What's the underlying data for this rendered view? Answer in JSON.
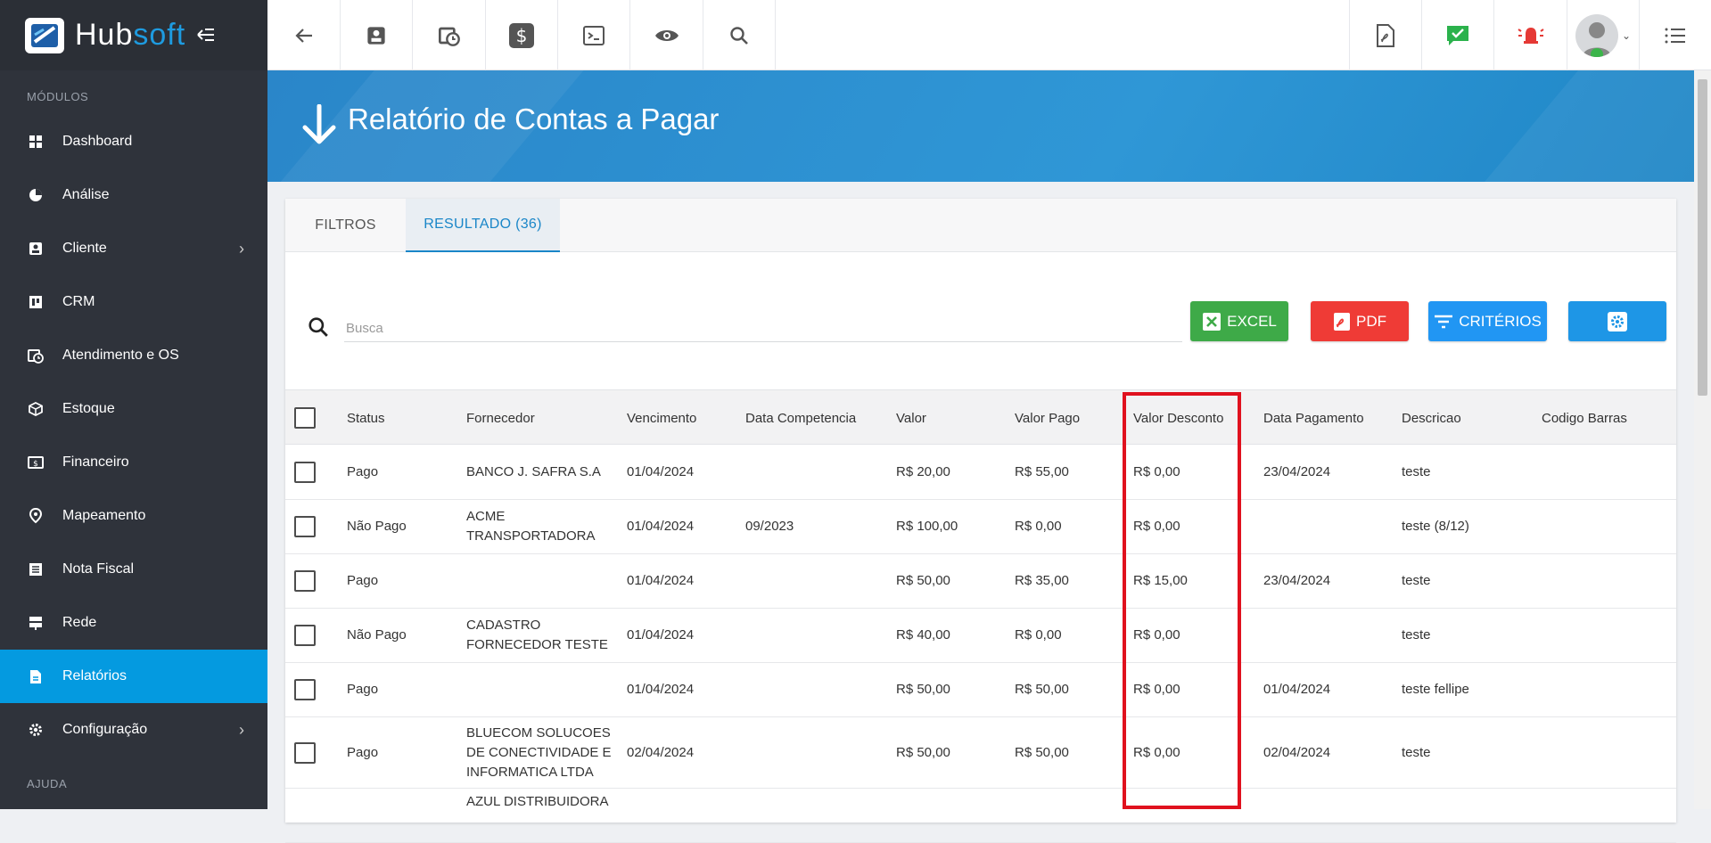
{
  "brand": {
    "name_part1": "Hub",
    "name_part2": "soft"
  },
  "sidebar": {
    "modules_label": "MÓDULOS",
    "help_label": "AJUDA",
    "items": [
      {
        "label": "Dashboard",
        "icon": "dashboard-icon"
      },
      {
        "label": "Análise",
        "icon": "pie-chart-icon"
      },
      {
        "label": "Cliente",
        "icon": "contact-card-icon",
        "has_submenu": true
      },
      {
        "label": "CRM",
        "icon": "kanban-icon"
      },
      {
        "label": "Atendimento e OS",
        "icon": "calendar-clock-icon"
      },
      {
        "label": "Estoque",
        "icon": "box-icon"
      },
      {
        "label": "Financeiro",
        "icon": "money-icon"
      },
      {
        "label": "Mapeamento",
        "icon": "map-pin-icon"
      },
      {
        "label": "Nota Fiscal",
        "icon": "invoice-icon"
      },
      {
        "label": "Rede",
        "icon": "server-icon"
      },
      {
        "label": "Relatórios",
        "icon": "report-icon",
        "active": true
      },
      {
        "label": "Configuração",
        "icon": "gear-icon",
        "has_submenu": true
      }
    ]
  },
  "topbar": {
    "icons": [
      "back-arrow-icon",
      "contact-card-icon",
      "calendar-clock-icon",
      "dollar-icon",
      "terminal-icon",
      "eye-icon",
      "search-icon",
      "pdf-icon",
      "chat-check-icon",
      "alarm-icon",
      "avatar",
      "list-menu-icon"
    ]
  },
  "page": {
    "title": "Relatório de Contas a Pagar"
  },
  "tabs": {
    "filters": "FILTROS",
    "result": "RESULTADO (36)"
  },
  "search": {
    "placeholder": "Busca",
    "value": ""
  },
  "actions": {
    "excel": "EXCEL",
    "pdf": "PDF",
    "criteria": "CRITÉRIOS"
  },
  "colors": {
    "sidebar_bg": "#2f333b",
    "accent": "#049ae0",
    "excel": "#3eaa48",
    "pdf": "#ef3b36",
    "criteria": "#2196f3",
    "settings": "#1e96e6",
    "highlight": "#e0111e"
  },
  "table": {
    "headers": {
      "status": "Status",
      "supplier": "Fornecedor",
      "due": "Vencimento",
      "competence": "Data Competencia",
      "value": "Valor",
      "paid": "Valor Pago",
      "discount": "Valor Desconto",
      "payment_date": "Data Pagamento",
      "description": "Descricao",
      "barcode": "Codigo Barras"
    },
    "rows": [
      {
        "status": "Pago",
        "supplier": "BANCO J. SAFRA S.A",
        "due": "01/04/2024",
        "competence": "",
        "value": "R$ 20,00",
        "paid": "R$ 55,00",
        "discount": "R$ 0,00",
        "payment_date": "23/04/2024",
        "description": "teste",
        "barcode": ""
      },
      {
        "status": "Não Pago",
        "supplier": "ACME\nTRANSPORTADORA",
        "due": "01/04/2024",
        "competence": "09/2023",
        "value": "R$ 100,00",
        "paid": "R$ 0,00",
        "discount": "R$ 0,00",
        "payment_date": "",
        "description": "teste (8/12)",
        "barcode": ""
      },
      {
        "status": "Pago",
        "supplier": "",
        "due": "01/04/2024",
        "competence": "",
        "value": "R$ 50,00",
        "paid": "R$ 35,00",
        "discount": "R$ 15,00",
        "payment_date": "23/04/2024",
        "description": "teste",
        "barcode": ""
      },
      {
        "status": "Não Pago",
        "supplier": "CADASTRO\nFORNECEDOR TESTE",
        "due": "01/04/2024",
        "competence": "",
        "value": "R$ 40,00",
        "paid": "R$ 0,00",
        "discount": "R$ 0,00",
        "payment_date": "",
        "description": "teste",
        "barcode": ""
      },
      {
        "status": "Pago",
        "supplier": "",
        "due": "01/04/2024",
        "competence": "",
        "value": "R$ 50,00",
        "paid": "R$ 50,00",
        "discount": "R$ 0,00",
        "payment_date": "01/04/2024",
        "description": "teste fellipe",
        "barcode": ""
      },
      {
        "status": "Pago",
        "supplier": "BLUECOM SOLUCOES\nDE CONECTIVIDADE E\nINFORMATICA LTDA",
        "due": "02/04/2024",
        "competence": "",
        "value": "R$ 50,00",
        "paid": "R$ 50,00",
        "discount": "R$ 0,00",
        "payment_date": "02/04/2024",
        "description": "teste",
        "barcode": ""
      },
      {
        "status": "",
        "supplier": "AZUL DISTRIBUIDORA",
        "due": "",
        "competence": "",
        "value": "",
        "paid": "",
        "discount": "",
        "payment_date": "",
        "description": "",
        "barcode": ""
      }
    ]
  }
}
